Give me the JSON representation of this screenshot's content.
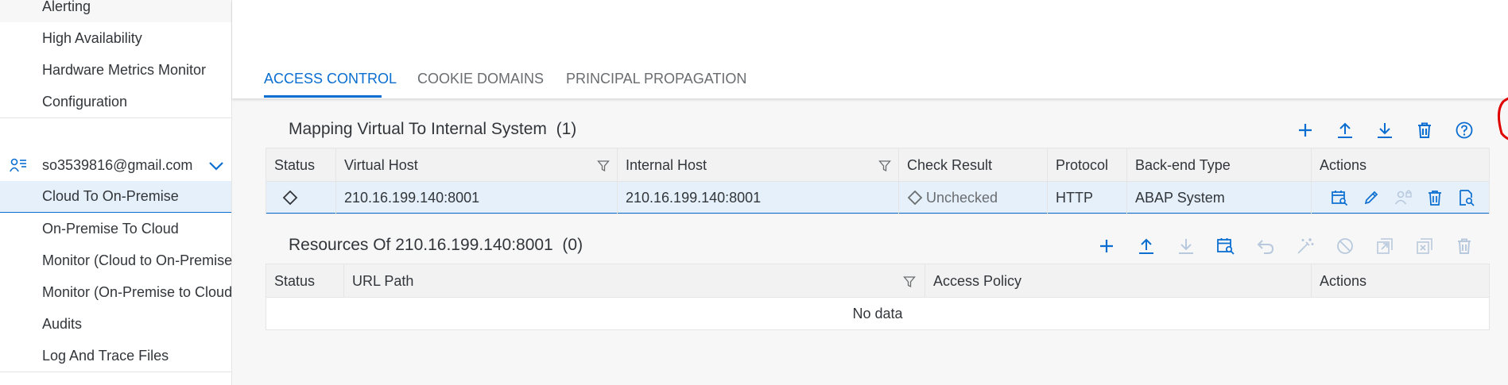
{
  "sidebar": {
    "items_top": [
      {
        "label": "Alerting"
      },
      {
        "label": "High Availability"
      },
      {
        "label": "Hardware Metrics Monitor"
      },
      {
        "label": "Configuration"
      }
    ],
    "user": {
      "label": "so3539816@gmail.com",
      "icon": "user-list-icon",
      "expand_icon": "chevron-down-icon"
    },
    "items_sub": [
      {
        "label": "Cloud To On-Premise",
        "selected": true
      },
      {
        "label": "On-Premise To Cloud"
      },
      {
        "label": "Monitor (Cloud to On-Premise)"
      },
      {
        "label": "Monitor (On-Premise to Cloud)"
      },
      {
        "label": "Audits"
      },
      {
        "label": "Log And Trace Files"
      }
    ]
  },
  "tabs": [
    {
      "label": "ACCESS CONTROL",
      "active": true
    },
    {
      "label": "COOKIE DOMAINS"
    },
    {
      "label": "PRINCIPAL PROPAGATION"
    }
  ],
  "mapping": {
    "title": "Mapping Virtual To Internal System",
    "count": "(1)",
    "toolbar": [
      "add-icon",
      "upload-icon",
      "download-icon",
      "delete-icon",
      "help-icon"
    ],
    "columns": [
      "Status",
      "Virtual Host",
      "Internal Host",
      "Check Result",
      "Protocol",
      "Back-end Type",
      "Actions"
    ],
    "rows": [
      {
        "virtual_host": "210.16.199.140:8001",
        "internal_host": "210.16.199.140:8001",
        "check_result": "Unchecked",
        "protocol": "HTTP",
        "backend_type": "ABAP System",
        "actions": [
          "check-availability-icon",
          "edit-icon",
          "principal-type-icon",
          "delete-icon",
          "show-details-icon"
        ]
      }
    ]
  },
  "resources": {
    "title": "Resources Of 210.16.199.140:8001",
    "count": "(0)",
    "toolbar": [
      "add-icon",
      "upload-icon",
      "download-icon",
      "check-availability-icon",
      "undo-icon",
      "wand-icon",
      "disable-icon",
      "open-icon",
      "close-icon",
      "delete-icon"
    ],
    "columns": [
      "Status",
      "URL Path",
      "Access Policy",
      "Actions"
    ],
    "empty_text": "No data"
  },
  "colors": {
    "accent": "#0a6ed1",
    "selected_row": "#e5f0fa",
    "annotation": "#e00000",
    "disabled_icon": "#b8c9dd"
  }
}
